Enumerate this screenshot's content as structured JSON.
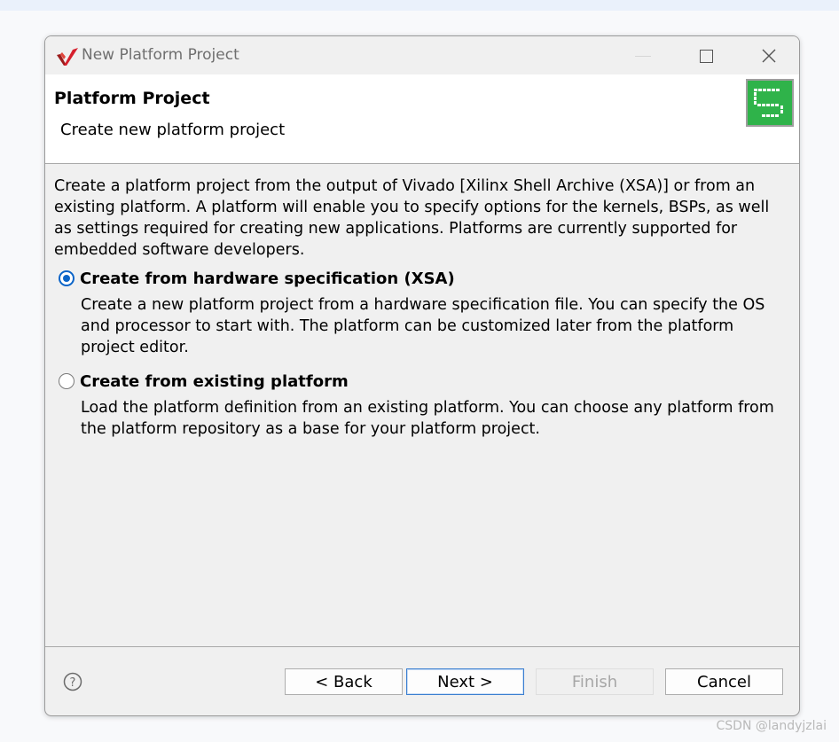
{
  "window": {
    "title": "New Platform Project"
  },
  "header": {
    "title": "Platform Project",
    "subtitle": "Create new platform project"
  },
  "content": {
    "description": "Create a platform project from the output of Vivado [Xilinx Shell Archive (XSA)] or from an existing platform. A platform will enable you to specify options for the kernels, BSPs, as well as settings required for creating new applications. Platforms are currently supported for embedded software developers.",
    "options": [
      {
        "label": "Create from hardware specification (XSA)",
        "description": "Create a new platform project from a hardware specification file. You can specify the OS and processor to start with. The platform can be customized later from the platform project editor.",
        "selected": true
      },
      {
        "label": "Create from existing platform",
        "description": "Load the platform definition from an existing platform. You can choose any platform from the platform repository as a base for your platform project.",
        "selected": false
      }
    ]
  },
  "footer": {
    "back_label": "< Back",
    "next_label": "Next >",
    "finish_label": "Finish",
    "finish_enabled": false,
    "cancel_label": "Cancel"
  },
  "watermark": "CSDN @landyjzlai",
  "icons": {
    "app": "vitis-logo-icon",
    "wizard": "platform-wizard-icon",
    "help": "help-icon",
    "minimize": "minimize-icon",
    "maximize": "maximize-icon",
    "close": "close-icon"
  },
  "colors": {
    "accent": "#0a64c8",
    "wizard_icon_bg": "#2fb34a",
    "logo_red": "#c8102e"
  }
}
